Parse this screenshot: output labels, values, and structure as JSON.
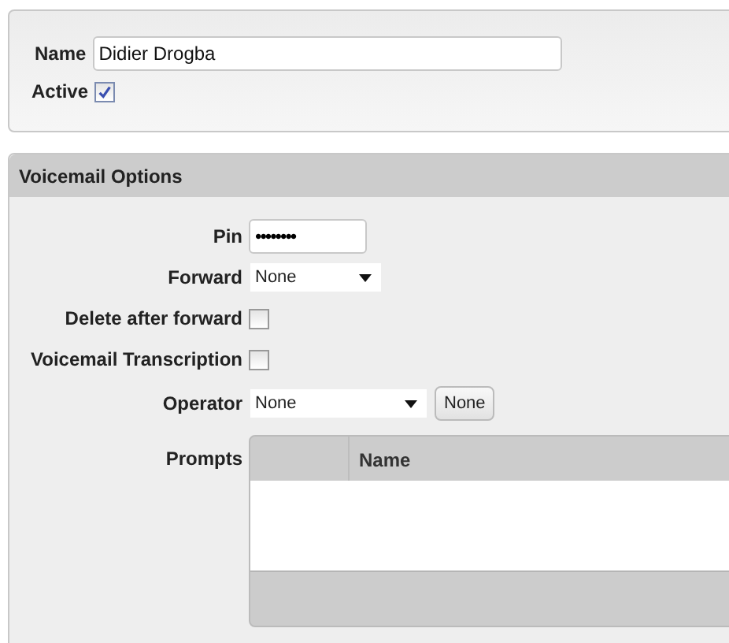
{
  "general": {
    "name_label": "Name",
    "name_value": "Didier Drogba",
    "active_label": "Active",
    "active_checked": true
  },
  "voicemail": {
    "title": "Voicemail Options",
    "fields": [
      {
        "kind": "text",
        "label": "Pin",
        "value": "••••••••"
      },
      {
        "kind": "select",
        "label": "Forward",
        "value": "None"
      },
      {
        "kind": "checkbox",
        "label": "Delete after forward",
        "checked": false
      },
      {
        "kind": "checkbox",
        "label": "Voicemail Transcription",
        "checked": false
      },
      {
        "kind": "select-button",
        "label": "Operator",
        "value": "None",
        "button": "None"
      }
    ],
    "prompts": {
      "label": "Prompts",
      "columns": [
        "Name"
      ]
    }
  }
}
